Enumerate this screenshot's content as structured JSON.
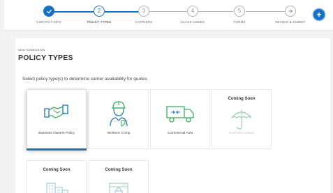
{
  "stepper": {
    "steps": [
      {
        "number": "1",
        "label": "CONTACT INFO",
        "state": "done"
      },
      {
        "number": "2",
        "label": "POLICY TYPES",
        "state": "current"
      },
      {
        "number": "3",
        "label": "CARRIERS",
        "state": "todo"
      },
      {
        "number": "4",
        "label": "CLASS CODES",
        "state": "todo"
      },
      {
        "number": "5",
        "label": "FORMS",
        "state": "todo"
      },
      {
        "number": "",
        "label": "REVIEW & SUBMIT",
        "state": "todo"
      }
    ],
    "add_icon": "plus-icon"
  },
  "page": {
    "kicker": "NEW SUBMISSION",
    "title": "POLICY TYPES",
    "instruction": "Select policy type(s) to determine carrier availability for quotes"
  },
  "tiles": [
    {
      "label": "Business Owners Policy",
      "icon": "handshake-icon",
      "selected": true,
      "coming_soon": false
    },
    {
      "label": "Workers' Comp",
      "icon": "worker-hardhat-icon",
      "selected": false,
      "coming_soon": false
    },
    {
      "label": "Commercial Auto",
      "icon": "truck-icon",
      "selected": false,
      "coming_soon": false
    },
    {
      "label": "Umbrella Liability",
      "icon": "umbrella-icon",
      "selected": false,
      "coming_soon": true,
      "badge": "Coming Soon"
    },
    {
      "label": "",
      "icon": "buildings-icon",
      "selected": false,
      "coming_soon": true,
      "badge": "Coming Soon"
    },
    {
      "label": "",
      "icon": "browser-lock-icon",
      "selected": false,
      "coming_soon": true,
      "badge": "Coming Soon"
    }
  ],
  "colors": {
    "accent": "#1872c4",
    "accent_light": "#8cbbe6",
    "icon_green": "#3fae5b",
    "muted": "#c8c8c8"
  }
}
